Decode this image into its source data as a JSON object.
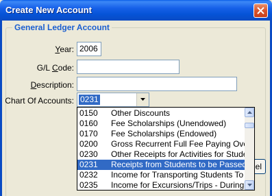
{
  "window": {
    "title": "Create New Account"
  },
  "group": {
    "legend": "General Ledger Account"
  },
  "fields": {
    "year": {
      "label_key": "Y",
      "label_rest": "ear:",
      "value": "2006"
    },
    "gl_code": {
      "label_pre": "G/L ",
      "label_key": "C",
      "label_rest": "ode:",
      "value": ""
    },
    "description": {
      "label_key": "D",
      "label_rest": "escription:",
      "value": ""
    },
    "chart_of_accounts": {
      "label": "Chart Of Accounts:",
      "value": "0231"
    }
  },
  "dropdown": {
    "items": [
      {
        "code": "0150",
        "desc": "Other Discounts"
      },
      {
        "code": "0160",
        "desc": "Fee Scholarships (Unendowed)"
      },
      {
        "code": "0170",
        "desc": "Fee Scholarships (Endowed)"
      },
      {
        "code": "0200",
        "desc": "Gross Recurrent Full Fee Paying Overseas"
      },
      {
        "code": "0230",
        "desc": "Other Receipts for Activities for Students"
      },
      {
        "code": "0231",
        "desc": "Receipts from Students to be Passed to a"
      },
      {
        "code": "0232",
        "desc": "Income for Transporting Students To and"
      },
      {
        "code": "0235",
        "desc": "Income for Excursions/Trips - During Sch"
      }
    ],
    "selected_index": 5
  },
  "partial_button": {
    "visible_text": "el"
  },
  "colors": {
    "accent": "#316ac5",
    "titlebar": "#0a5ee8",
    "legend": "#1c5fd0"
  }
}
